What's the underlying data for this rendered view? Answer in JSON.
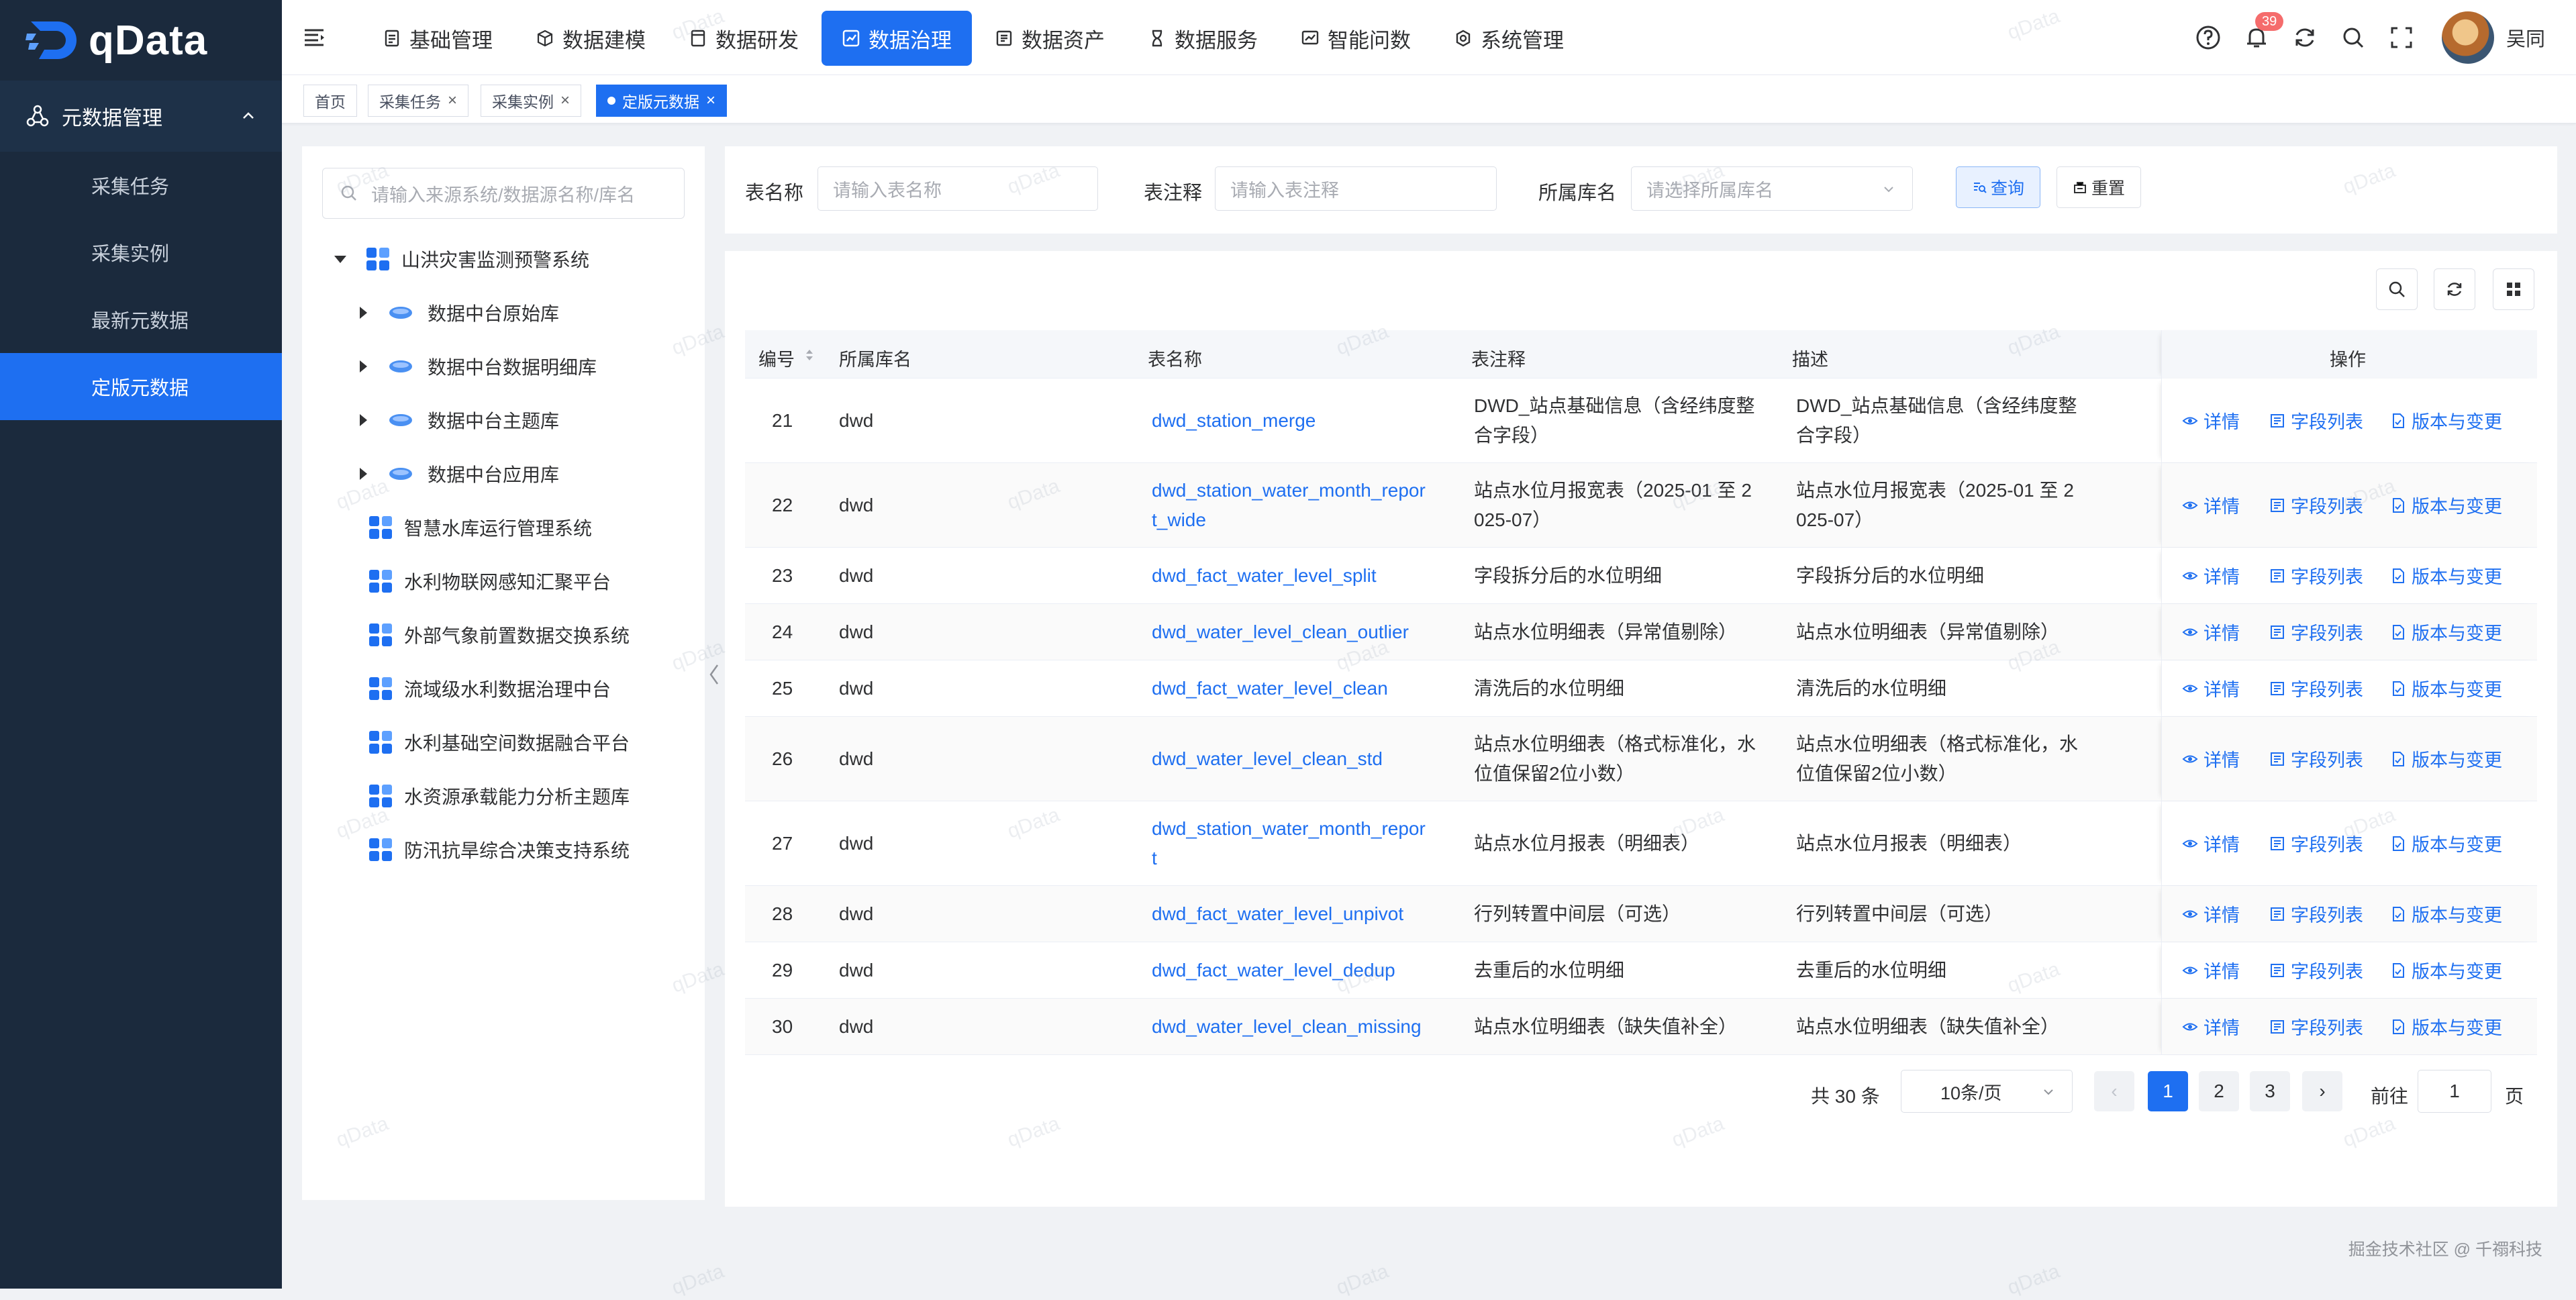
{
  "app": {
    "logo_text": "qData"
  },
  "sidebar": {
    "group": {
      "label": "元数据管理",
      "icon": "share-nodes-icon"
    },
    "items": [
      {
        "label": "采集任务",
        "active": false
      },
      {
        "label": "采集实例",
        "active": false
      },
      {
        "label": "最新元数据",
        "active": false
      },
      {
        "label": "定版元数据",
        "active": true
      }
    ]
  },
  "topnav": {
    "items": [
      {
        "label": "基础管理",
        "icon": "doc-icon"
      },
      {
        "label": "数据建模",
        "icon": "cube-icon"
      },
      {
        "label": "数据研发",
        "icon": "file-icon"
      },
      {
        "label": "数据治理",
        "icon": "governance-icon",
        "active": true
      },
      {
        "label": "数据资产",
        "icon": "asset-icon"
      },
      {
        "label": "数据服务",
        "icon": "hourglass-icon"
      },
      {
        "label": "智能问数",
        "icon": "chart-icon"
      },
      {
        "label": "系统管理",
        "icon": "gear-icon"
      }
    ],
    "notification_count": "39",
    "username": "吴同"
  },
  "tags": [
    {
      "label": "首页",
      "closable": false
    },
    {
      "label": "采集任务",
      "closable": true
    },
    {
      "label": "采集实例",
      "closable": true
    },
    {
      "label": "定版元数据",
      "closable": true,
      "active": true
    }
  ],
  "tree": {
    "search_placeholder": "请输入来源系统/数据源名称/库名",
    "nodes": [
      {
        "label": "山洪灾害监测预警系统",
        "level": 0,
        "expanded": true,
        "icon": "grid"
      },
      {
        "label": "数据中台原始库",
        "level": 1,
        "icon": "db"
      },
      {
        "label": "数据中台数据明细库",
        "level": 1,
        "icon": "db"
      },
      {
        "label": "数据中台主题库",
        "level": 1,
        "icon": "db"
      },
      {
        "label": "数据中台应用库",
        "level": 1,
        "icon": "db"
      },
      {
        "label": "智慧水库运行管理系统",
        "level": 0,
        "icon": "grid"
      },
      {
        "label": "水利物联网感知汇聚平台",
        "level": 0,
        "icon": "grid"
      },
      {
        "label": "外部气象前置数据交换系统",
        "level": 0,
        "icon": "grid"
      },
      {
        "label": "流域级水利数据治理中台",
        "level": 0,
        "icon": "grid"
      },
      {
        "label": "水利基础空间数据融合平台",
        "level": 0,
        "icon": "grid"
      },
      {
        "label": "水资源承载能力分析主题库",
        "level": 0,
        "icon": "grid"
      },
      {
        "label": "防汛抗旱综合决策支持系统",
        "level": 0,
        "icon": "grid"
      }
    ]
  },
  "filters": {
    "table_name_label": "表名称",
    "table_name_placeholder": "请输入表名称",
    "comment_label": "表注释",
    "comment_placeholder": "请输入表注释",
    "db_label": "所属库名",
    "db_placeholder": "请选择所属库名",
    "query_label": "查询",
    "reset_label": "重置"
  },
  "table": {
    "headers": {
      "id": "编号",
      "db": "所属库名",
      "name": "表名称",
      "comment": "表注释",
      "desc": "描述",
      "ops": "操作"
    },
    "op_labels": {
      "detail": "详情",
      "fields": "字段列表",
      "version": "版本与变更"
    },
    "rows": [
      {
        "id": "21",
        "db": "dwd",
        "name": [
          "dwd_station_merge"
        ],
        "comment": [
          "DWD_站点基础信息（含经纬度整",
          "合字段）"
        ],
        "desc": [
          "DWD_站点基础信息（含经纬度整",
          "合字段）"
        ]
      },
      {
        "id": "22",
        "db": "dwd",
        "name": [
          "dwd_station_water_month_repor",
          "t_wide"
        ],
        "comment": [
          "站点水位月报宽表（2025-01 至 2",
          "025-07）"
        ],
        "desc": [
          "站点水位月报宽表（2025-01 至 2",
          "025-07）"
        ]
      },
      {
        "id": "23",
        "db": "dwd",
        "name": [
          "dwd_fact_water_level_split"
        ],
        "comment": [
          "字段拆分后的水位明细"
        ],
        "desc": [
          "字段拆分后的水位明细"
        ]
      },
      {
        "id": "24",
        "db": "dwd",
        "name": [
          "dwd_water_level_clean_outlier"
        ],
        "comment": [
          "站点水位明细表（异常值剔除）"
        ],
        "desc": [
          "站点水位明细表（异常值剔除）"
        ]
      },
      {
        "id": "25",
        "db": "dwd",
        "name": [
          "dwd_fact_water_level_clean"
        ],
        "comment": [
          "清洗后的水位明细"
        ],
        "desc": [
          "清洗后的水位明细"
        ]
      },
      {
        "id": "26",
        "db": "dwd",
        "name": [
          "dwd_water_level_clean_std"
        ],
        "comment": [
          "站点水位明细表（格式标准化，水",
          "位值保留2位小数）"
        ],
        "desc": [
          "站点水位明细表（格式标准化，水",
          "位值保留2位小数）"
        ]
      },
      {
        "id": "27",
        "db": "dwd",
        "name": [
          "dwd_station_water_month_repor",
          "t"
        ],
        "comment": [
          "站点水位月报表（明细表）"
        ],
        "desc": [
          "站点水位月报表（明细表）"
        ]
      },
      {
        "id": "28",
        "db": "dwd",
        "name": [
          "dwd_fact_water_level_unpivot"
        ],
        "comment": [
          "行列转置中间层（可选）"
        ],
        "desc": [
          "行列转置中间层（可选）"
        ]
      },
      {
        "id": "29",
        "db": "dwd",
        "name": [
          "dwd_fact_water_level_dedup"
        ],
        "comment": [
          "去重后的水位明细"
        ],
        "desc": [
          "去重后的水位明细"
        ]
      },
      {
        "id": "30",
        "db": "dwd",
        "name": [
          "dwd_water_level_clean_missing"
        ],
        "comment": [
          "站点水位明细表（缺失值补全）"
        ],
        "desc": [
          "站点水位明细表（缺失值补全）"
        ]
      }
    ]
  },
  "pagination": {
    "total_text": "共 30 条",
    "page_size": "10条/页",
    "pages": [
      "1",
      "2",
      "3"
    ],
    "current": "1",
    "goto_label": "前往",
    "goto_value": "1",
    "page_unit": "页"
  },
  "footer": "掘金技术社区 @ 千禤科技",
  "watermark": "qData",
  "colors": {
    "primary": "#1e6ff1",
    "sidebar_bg": "#1b2a3d"
  }
}
